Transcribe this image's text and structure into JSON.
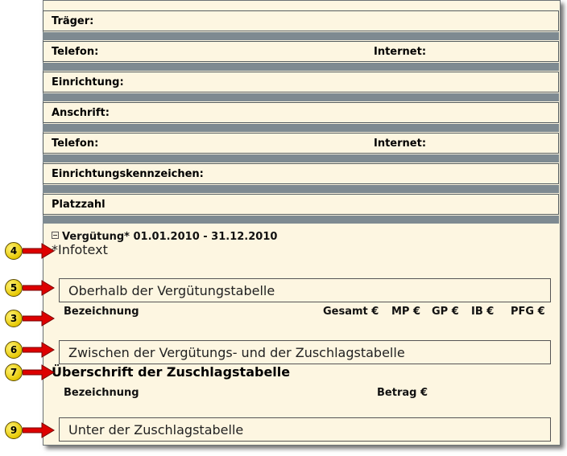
{
  "fields": {
    "traeger": "Träger:",
    "telefon1": "Telefon:",
    "internet1": "Internet:",
    "einrichtung": "Einrichtung:",
    "anschrift": "Anschrift:",
    "telefon2": "Telefon:",
    "internet2": "Internet:",
    "kennzeichen": "Einrichtungskennzeichen:",
    "platzzahl": "Platzzahl"
  },
  "section": {
    "title": "Vergütung* 01.01.2010 - 31.12.2010",
    "infotext": "*Infotext"
  },
  "boxes": {
    "oberhalb": "Oberhalb der Vergütungstabelle",
    "zwischen": "Zwischen der Vergütungs- und der Zuschlagstabelle",
    "unter": "Unter der Zuschlagstabelle"
  },
  "verguetung_table": {
    "headers": [
      "Bezeichnung",
      "Gesamt €",
      "MP €",
      "GP €",
      "IB €",
      "PFG €"
    ]
  },
  "zuschlag": {
    "heading": "Überschrift der Zuschlagstabelle",
    "headers": [
      "Bezeichnung",
      "Betrag €"
    ]
  },
  "badges": [
    "4",
    "5",
    "3",
    "6",
    "7",
    "9"
  ],
  "colors": {
    "panel_bg": "#fdf6e1",
    "separator": "#7e8a91",
    "arrow_red": "#dd0000",
    "badge_yellow": "#f2dc1e"
  }
}
